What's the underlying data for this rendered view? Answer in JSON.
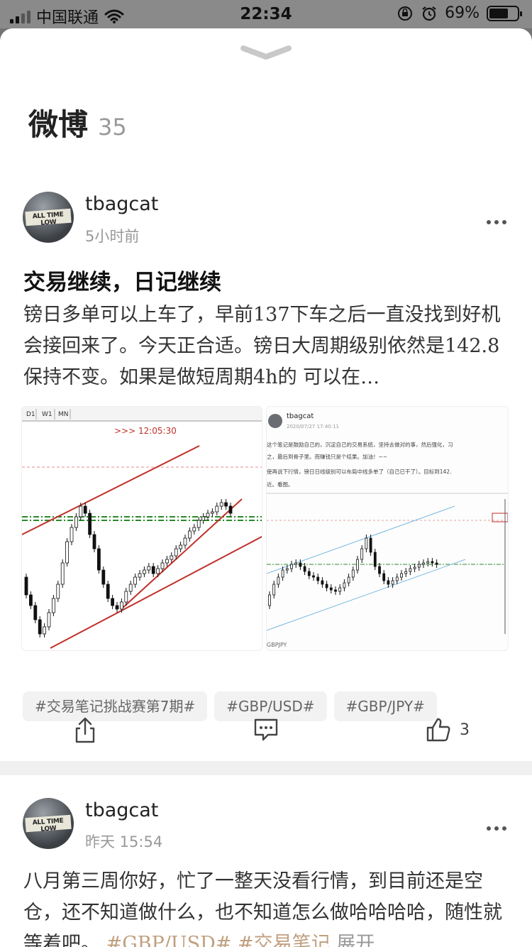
{
  "status_bar": {
    "carrier": "中国联通",
    "time": "22:34",
    "battery": "69%",
    "battery_level": 0.69
  },
  "sheet": {
    "title": "微博",
    "count": "35"
  },
  "posts": [
    {
      "username": "tbagcat",
      "time": "5小时前",
      "title": "交易继续，日记继续",
      "body": "镑日多单可以上车了，早前137下车之后一直没找到好机会接回来了。今天正合适。镑日大周期级别依然是142.8保持不变。如果是做短周期4h的 可以在…",
      "images": {
        "left_tabs": [
          "D1",
          "W1",
          "MN"
        ],
        "left_timer": ">>> 12:05:30",
        "right_user": "tbagcat",
        "right_time": "2020/07/27 17:40:11",
        "right_line1": "这个笔记是鼓励自己的，沉淀自己的交易系统，坚持去做对的事，然后强化，习",
        "right_line2": "之，最后到骨子里。而赚钱只是个结果。加油！~~",
        "right_line3": "使再说下行情，镑日日线级别可以布局中线多单了（自己已干了）。目标到142.",
        "right_line4": "近。看图。",
        "right_chart_label": "GBPJPY"
      },
      "tags": [
        "#交易笔记挑战赛第7期#",
        "#GBP/USD#",
        "#GBP/JPY#"
      ],
      "likes": "3"
    },
    {
      "username": "tbagcat",
      "time": "昨天 15:54",
      "body_text": "八月第三周你好，忙了一整天没看行情，到目前还是空仓，还不知道做什么，也不知道怎么做哈哈哈哈，随性就等着吧。",
      "body_link1": "#GBP/USD#",
      "body_link2": "#交易笔记",
      "body_more": "展开"
    }
  ],
  "avatar_text": "ALL TIME LOW",
  "colors": {
    "sheet_bg": "#ffffff",
    "tag_bg": "#f2f2f2",
    "link": "#c0a080",
    "chart_line": "#c0302a",
    "chart_green": "#2a8a2a"
  }
}
